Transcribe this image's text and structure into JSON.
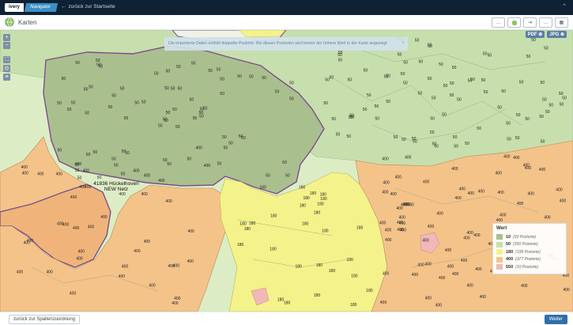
{
  "app": {
    "logo_text": "ivery",
    "product_label": "Navigator",
    "back_link": "zurück zur Startseite",
    "collapse_icon": "chevron-up-icon"
  },
  "header": {
    "title": "Karten",
    "tool_buttons": [
      "...",
      "",
      "",
      "...",
      ""
    ]
  },
  "map": {
    "notice": "Die importierte Daten enthält doppelte Postorte. Bei diesen Postorten wird immer der höhere Wert in der Karte angezeigt",
    "notice_close": "×",
    "place_name": "41836 Hückelhoven",
    "place_sub": "NEW Netz",
    "export_pdf": "PDF ⊕",
    "export_jpg": "JPG ⊕",
    "zoom_in": "+",
    "zoom_out": "−",
    "colors": {
      "green_dark": "#aabf8e",
      "green_mid": "#c7dfac",
      "green_light": "#dcedc5",
      "yellow": "#f4f28a",
      "orange": "#f4c38a",
      "pink": "#f2b8b8",
      "border": "#7a4f8c"
    }
  },
  "legend": {
    "title": "Wert",
    "items": [
      {
        "value": "10",
        "count": "(93 Postorte)",
        "color": "#aabf8e"
      },
      {
        "value": "50",
        "count": "(350 Postorte)",
        "color": "#c7dfac"
      },
      {
        "value": "180",
        "count": "(199 Postorte)",
        "color": "#f4f28a"
      },
      {
        "value": "400",
        "count": "(377 Postorte)",
        "color": "#f4c38a"
      },
      {
        "value": "550",
        "count": "(10 Postorte)",
        "color": "#f2b8b8"
      }
    ]
  },
  "footer": {
    "back_button": "zurück zur Spaltenzuordnung",
    "next_button": "Weiter"
  },
  "labels": {
    "v50": "50",
    "v180": "180",
    "v400": "400"
  }
}
